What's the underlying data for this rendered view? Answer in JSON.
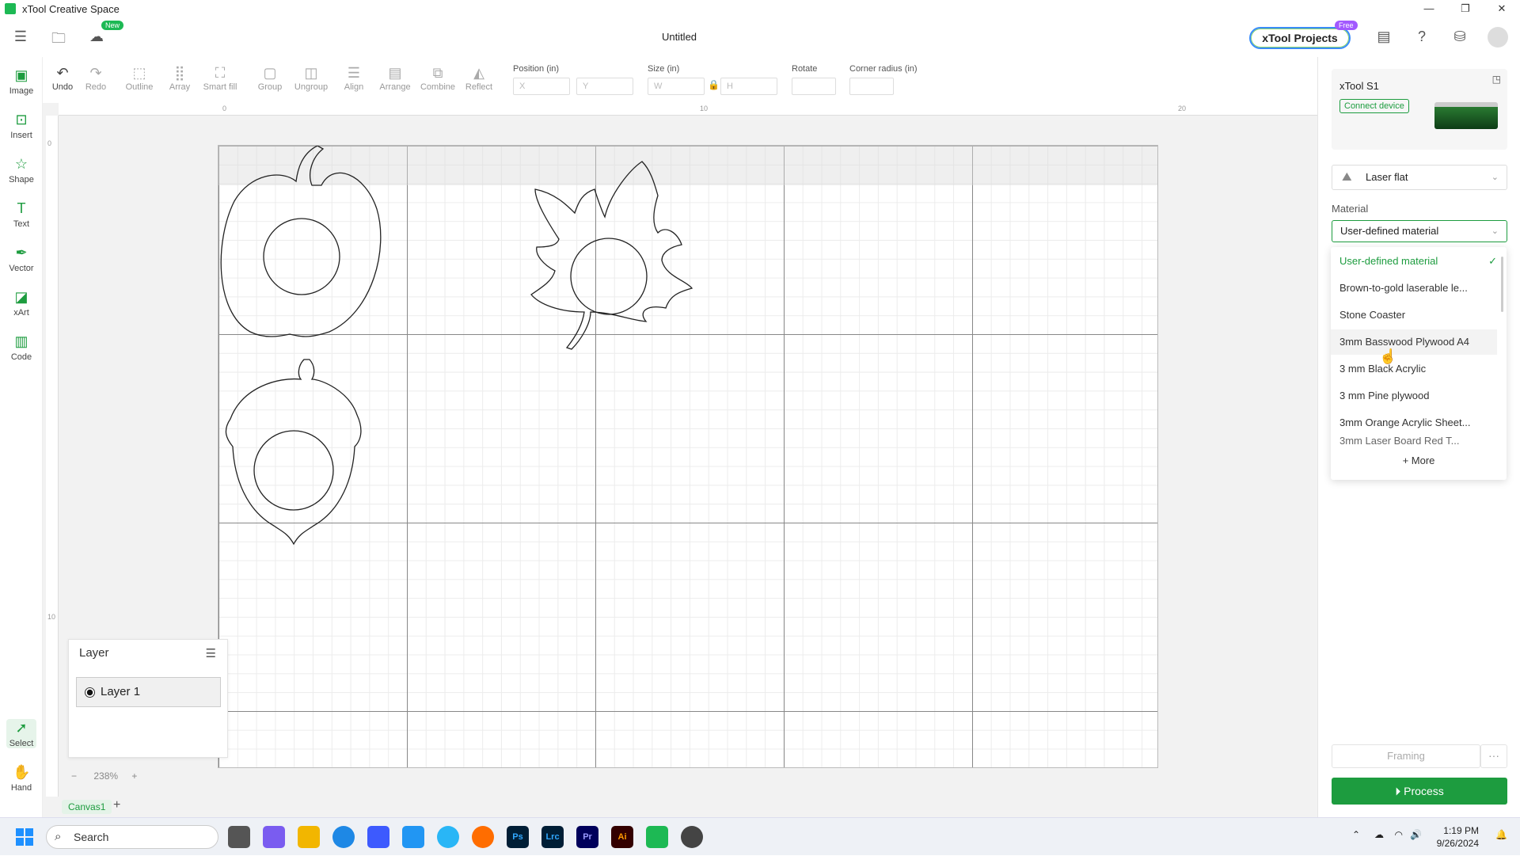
{
  "window": {
    "app_title": "xTool Creative Space",
    "controls": [
      "—",
      "❐",
      "✕"
    ]
  },
  "header": {
    "new_badge": "New",
    "document_title": "Untitled",
    "projects_label": "xTool Projects",
    "free_badge": "Free"
  },
  "left_tools": [
    {
      "label": "Image",
      "icon": "image-icon"
    },
    {
      "label": "Insert",
      "icon": "insert-icon"
    },
    {
      "label": "Shape",
      "icon": "shape-icon"
    },
    {
      "label": "Text",
      "icon": "text-icon"
    },
    {
      "label": "Vector",
      "icon": "pen-icon"
    },
    {
      "label": "xArt",
      "icon": "ai-icon"
    },
    {
      "label": "Code",
      "icon": "barcode-icon"
    },
    {
      "label": "Select",
      "icon": "cursor-icon"
    },
    {
      "label": "Hand",
      "icon": "hand-icon"
    }
  ],
  "toolbar": {
    "undo": "Undo",
    "redo": "Redo",
    "outline": "Outline",
    "array": "Array",
    "smart_fill": "Smart fill",
    "group": "Group",
    "ungroup": "Ungroup",
    "align": "Align",
    "arrange": "Arrange",
    "combine": "Combine",
    "reflect": "Reflect",
    "position_label": "Position (in)",
    "x_placeholder": "X",
    "y_placeholder": "Y",
    "size_label": "Size (in)",
    "w_placeholder": "W",
    "h_placeholder": "H",
    "rotate_label": "Rotate",
    "corner_label": "Corner radius (in)"
  },
  "rulers": {
    "h_ticks": [
      "0",
      "10",
      "20"
    ],
    "v_ticks": [
      "0",
      "10"
    ]
  },
  "layer_panel": {
    "title": "Layer",
    "layers": [
      "Layer 1"
    ]
  },
  "zoom": {
    "minus": "−",
    "level": "238%",
    "plus": "+"
  },
  "canvas_tabs": {
    "current": "Canvas1",
    "add": "+"
  },
  "right_panel": {
    "device_name": "xTool S1",
    "connect_label": "Connect device",
    "mode": "Laser flat",
    "material_label": "Material",
    "material_selected": "User-defined material",
    "materials": [
      "User-defined material",
      "Brown-to-gold laserable le...",
      "Stone Coaster",
      "3mm Basswood Plywood A4",
      "3 mm Black Acrylic",
      "3 mm Pine plywood",
      "3mm Orange Acrylic Sheet...",
      "3mm Laser Board Red T..."
    ],
    "more_label": "More",
    "framing_label": "Framing",
    "framing_more": "···",
    "process_label": "Process"
  },
  "taskbar": {
    "search_placeholder": "Search",
    "time": "1:19 PM",
    "date": "9/26/2024",
    "apps": [
      "Ps",
      "Lrc",
      "Pr",
      "Ai"
    ]
  },
  "colors": {
    "accent": "#1d9c3f",
    "projects_border": "#3a8cff",
    "free_badge": "#a259ff"
  }
}
